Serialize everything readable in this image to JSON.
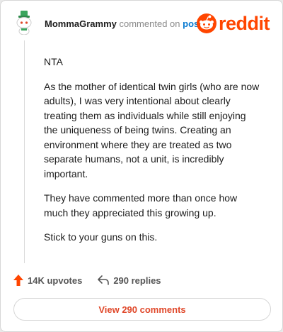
{
  "header": {
    "username": "MommaGrammy",
    "action": "commented on",
    "target": "post",
    "logo_text": "reddit"
  },
  "comment": {
    "paragraphs": [
      "NTA",
      "As the mother of identical twin girls (who are now adults), I was very intentional about clearly treating them as individuals while still enjoying the uniqueness of being twins. Creating an environment where they are treated as two separate humans, not a unit, is incredibly important.",
      "They have commented more than once how much they appreciated this growing up.",
      "Stick to your guns on this."
    ]
  },
  "stats": {
    "upvotes": "14K upvotes",
    "replies": "290 replies"
  },
  "view_button": "View 290 comments",
  "icons": {
    "avatar": "snoo-avatar-icon",
    "logo": "reddit-logo-icon",
    "upvote": "upvote-arrow-icon",
    "reply": "reply-arrow-icon"
  },
  "colors": {
    "brand": "#ff4500",
    "link": "#0a7ad1",
    "upvote": "#ff4500",
    "button_text": "#e0482a"
  }
}
